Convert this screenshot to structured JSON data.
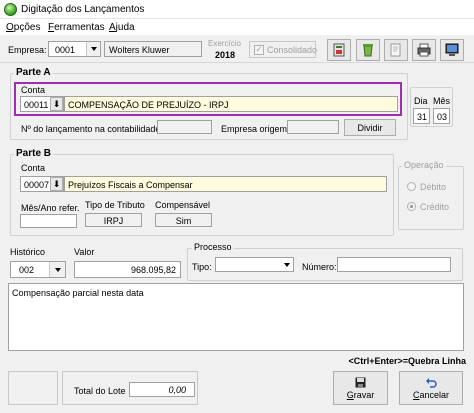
{
  "window": {
    "title": "Digitação dos Lançamentos"
  },
  "menu": [
    {
      "label": "Opções",
      "underline": "O",
      "rest": "pções"
    },
    {
      "label": "Ferramentas",
      "underline": "F",
      "rest": "erramentas"
    },
    {
      "label": "Ajuda",
      "underline": "A",
      "rest": "juda"
    }
  ],
  "header": {
    "empresa_label": "Empresa:",
    "empresa_code": "0001",
    "empresa_name": "Wolters Kluwer",
    "exercicio_label": "Exercício",
    "exercicio_value": "2018",
    "consolidado_label": "Consolidado"
  },
  "toolbar_icons": [
    "import-icon",
    "recycle-icon",
    "document-icon",
    "print-icon",
    "monitor-icon"
  ],
  "parte_a": {
    "group_label": "Parte A",
    "conta_label": "Conta",
    "conta_code": "00011",
    "conta_desc": "COMPENSAÇÃO DE PREJUÍZO - IRPJ",
    "dia_label": "Dia",
    "dia_value": "31",
    "mes_label": "Mês",
    "mes_value": "03",
    "nr_lanc_label": "Nº do lançamento na contabilidade:",
    "nr_lanc_value": "",
    "empresa_origem_label": "Empresa origem:",
    "empresa_origem_value": "",
    "dividir_label": "Dividir"
  },
  "parte_b": {
    "group_label": "Parte B",
    "conta_label": "Conta",
    "conta_code": "00007",
    "conta_desc": "Prejuízos Fiscais a Compensar",
    "mes_ano_label": "Mês/Ano refer.",
    "mes_ano_value": "",
    "tipo_tributo_label": "Tipo de Tributo",
    "tipo_tributo_value": "IRPJ",
    "compensavel_label": "Compensável",
    "compensavel_value": "Sim",
    "operacao_label": "Operação",
    "debito_label": "Débito",
    "credito_label": "Crédito"
  },
  "lancamento": {
    "historico_label": "Histórico",
    "historico_value": "002",
    "valor_label": "Valor",
    "valor_value": "968.095,82",
    "processo_label": "Processo",
    "tipo_label": "Tipo:",
    "tipo_value": "",
    "numero_label": "Número:",
    "numero_value": "",
    "complemento": "Compensação parcial nesta data",
    "shortcut_hint": "<Ctrl+Enter>=Quebra Linha"
  },
  "footer": {
    "total_lote_label": "Total do Lote",
    "total_lote_value": "0,00",
    "gravar_label": "Gravar",
    "gravar_underline": "G",
    "gravar_rest": "ravar",
    "cancelar_label": "Cancelar",
    "cancelar_underline": "C",
    "cancelar_rest": "ancelar"
  },
  "colors": {
    "highlight_border": "#9b2fae",
    "field_yellow": "#fffbdc",
    "window_bg": "#f0f0f0"
  }
}
